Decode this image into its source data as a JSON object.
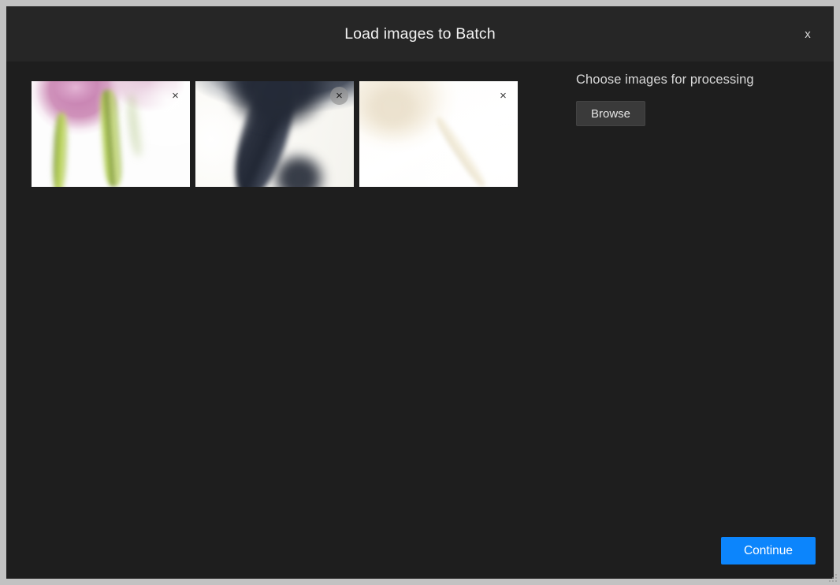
{
  "dialog": {
    "title": "Load images to Batch",
    "close_label": "x",
    "close_icon": "close-icon"
  },
  "thumbnails": {
    "remove_label": "×",
    "remove_icon": "close-circle-icon",
    "items": [
      {
        "name": "pink-tulips",
        "alt": "Pink tulip blossoms with green stems on a white background",
        "art": "art-tulips-pink",
        "remove_hovered": false
      },
      {
        "name": "dark-curve",
        "alt": "Dark navy curved organic shape on a cream background",
        "art": "art-dark-curve",
        "remove_hovered": true
      },
      {
        "name": "cream-tulip",
        "alt": "Pale ivory tulip bud with a slanted stem on white",
        "art": "art-tulip-cream",
        "remove_hovered": false
      }
    ]
  },
  "chooser": {
    "label": "Choose images for processing",
    "browse_label": "Browse"
  },
  "footer": {
    "continue_label": "Continue"
  },
  "colors": {
    "frame": "#c2c2c2",
    "dialog_background": "#1e1e1e",
    "titlebar_background": "#262626",
    "title_text": "#f2f2f2",
    "body_text": "#d9d9d9",
    "browse_background": "#3a3a3a",
    "accent": "#0c85fc",
    "accent_text": "#ffffff",
    "remove_badge": "#969696"
  }
}
